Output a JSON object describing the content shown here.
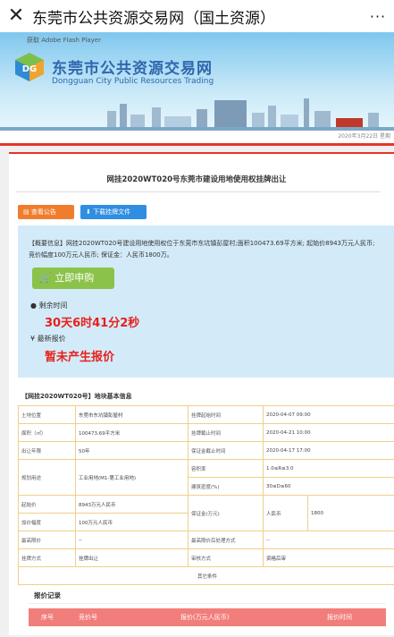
{
  "topbar": {
    "close": "✕",
    "title": "东莞市公共资源交易网（国土资源）",
    "more": "···"
  },
  "banner": {
    "flash": "获取 Adobe Flash Player",
    "title_cn": "东莞市公共资源交易网",
    "title_en": "Dongguan City Public Resources Trading",
    "date": "2020年3月22日 星期"
  },
  "page": {
    "title": "网挂2020WT020号东莞市建设用地使用权挂牌出让"
  },
  "buttons": {
    "notice": "查看公告",
    "files": "下载挂牌文件"
  },
  "summary": "【概要信息】网挂2020WT020号建设用地使用权位于东莞市东坑镇彭屋村;面积100473.69平方米; 起始价8943万元人民币; 竞价幅度100万元人民币; 保证金：人民币1800万。",
  "submit": "立即申购",
  "countdown": {
    "label": "剩余时间",
    "value": "30天6时41分2秒"
  },
  "price": {
    "label": "最新报价",
    "value": "暂未产生报价"
  },
  "section_title": "【网挂2020WT020号】地块基本信息",
  "table": {
    "location": {
      "k": "土地位置",
      "v": "东莞市东坑镇彭屋村"
    },
    "start_time": {
      "k": "挂牌起始时间",
      "v": "2020-04-07 09:00"
    },
    "area": {
      "k": "面积（㎡）",
      "v": "100473.69平方米"
    },
    "end_time": {
      "k": "挂牌截止时间",
      "v": "2020-04-21 10:00"
    },
    "term": {
      "k": "出让年限",
      "v": "50年"
    },
    "deposit_deadline": {
      "k": "保证金截止时间",
      "v": "2020-04-17 17:00"
    },
    "usage": {
      "k": "规划用途",
      "v": "工业用地(M1-第工业用地)"
    },
    "plot_ratio": {
      "k": "容积率",
      "v": "1.0≤R≤3.0"
    },
    "density": {
      "k": "建筑密度(%)",
      "v": "30≤D≤60"
    },
    "start_price": {
      "k": "起始价",
      "v": "8943万元人民币"
    },
    "deposit": {
      "k": "保证金(万元)",
      "v": "人民币",
      "amount": "1800"
    },
    "increment": {
      "k": "加价幅度",
      "v": "100万元人民币"
    },
    "max_price": {
      "k": "最高限价",
      "v": "--"
    },
    "after_max": {
      "k": "最高限价后处理方式",
      "v": "--"
    },
    "method": {
      "k": "挂牌方式",
      "v": "挂牌出让"
    },
    "review": {
      "k": "审核方式",
      "v": "资格后审"
    },
    "other": "其它条件"
  },
  "bids": {
    "title": "报价记录",
    "cols": [
      "序号",
      "竞价号",
      "报价(万元人民币)",
      "报价时间"
    ]
  }
}
